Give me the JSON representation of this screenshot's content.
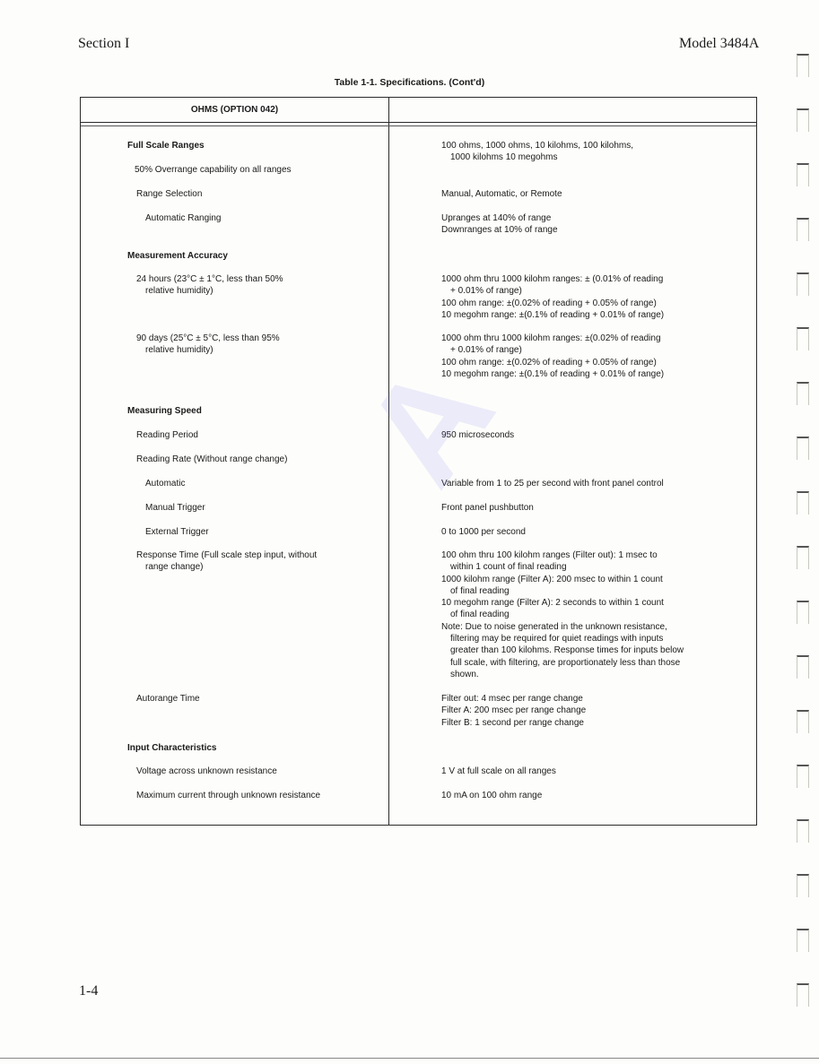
{
  "header": {
    "section": "Section I",
    "model": "Model 3484A"
  },
  "table_title": "Table 1-1.  Specifications. (Cont'd)",
  "table_header": {
    "left": "OHMS (OPTION 042)",
    "right": ""
  },
  "rows": [
    {
      "label": "Full Scale Ranges",
      "bold": true,
      "value": [
        "100 ohms, 1000 ohms, 10 kilohms, 100 kilohms,",
        "   1000 kilohms 10 megohms"
      ]
    },
    {
      "label": "50% Overrange capability on all ranges",
      "value": []
    },
    {
      "label": "Range Selection",
      "value": [
        "Manual, Automatic, or Remote"
      ]
    },
    {
      "label": "Automatic Ranging",
      "value": [
        "Upranges at 140% of range",
        "Downranges at 10% of range"
      ]
    },
    {
      "label": "Measurement Accuracy",
      "bold": true,
      "value": []
    },
    {
      "label": [
        "24 hours (23°C ± 1°C, less than 50%",
        "   relative humidity)"
      ],
      "value": [
        "1000 ohm thru 1000 kilohm ranges: ± (0.01% of reading",
        "   + 0.01% of range)",
        "100 ohm range: ±(0.02% of reading + 0.05% of range)",
        "10 megohm range: ±(0.1% of reading + 0.01% of range)"
      ]
    },
    {
      "label": [
        "90 days (25°C ± 5°C, less than 95%",
        "   relative humidity)"
      ],
      "value": [
        "1000 ohm thru 1000 kilohm ranges: ±(0.02% of reading",
        "   + 0.01% of range)",
        "100 ohm range: ±(0.02% of reading + 0.05% of range)",
        "10 megohm range: ±(0.1% of reading + 0.01% of range)"
      ]
    },
    {
      "label": "Measuring Speed",
      "bold": true,
      "value": []
    },
    {
      "label": "Reading Period",
      "value": [
        "950 microseconds"
      ]
    },
    {
      "label": "Reading Rate (Without range change)",
      "value": []
    },
    {
      "label": "Automatic",
      "value": [
        "Variable from 1 to 25 per second with front panel control"
      ]
    },
    {
      "label": "Manual Trigger",
      "value": [
        "Front panel pushbutton"
      ]
    },
    {
      "label": "External Trigger",
      "value": [
        "0 to 1000 per second"
      ]
    },
    {
      "label": [
        "Response Time (Full scale step input, without",
        "   range change)"
      ],
      "value": [
        "100 ohm thru 100 kilohm ranges (Filter out):  1 msec to",
        "   within 1 count of final reading",
        "1000 kilohm range (Filter A):  200 msec to within 1 count",
        "   of final reading",
        "10 megohm range (Filter A):  2 seconds to within 1 count",
        "   of final reading",
        "Note:  Due to noise generated in the unknown resistance,",
        "   filtering may be required for quiet readings with inputs",
        "   greater than 100 kilohms. Response times for inputs below",
        "   full scale, with filtering, are proportionately less than those",
        "   shown."
      ]
    },
    {
      "label": "Autorange Time",
      "value": [
        "Filter out:  4 msec per range change",
        "Filter A:  200 msec per range change",
        "Filter B:  1 second per range change"
      ]
    },
    {
      "label": "Input Characteristics",
      "bold": true,
      "value": []
    },
    {
      "label": "Voltage across unknown resistance",
      "value": [
        "1 V at full scale on all ranges"
      ]
    },
    {
      "label": "Maximum current through unknown resistance",
      "value": [
        "10 mA on 100 ohm range"
      ]
    }
  ],
  "page_number": "1-4"
}
